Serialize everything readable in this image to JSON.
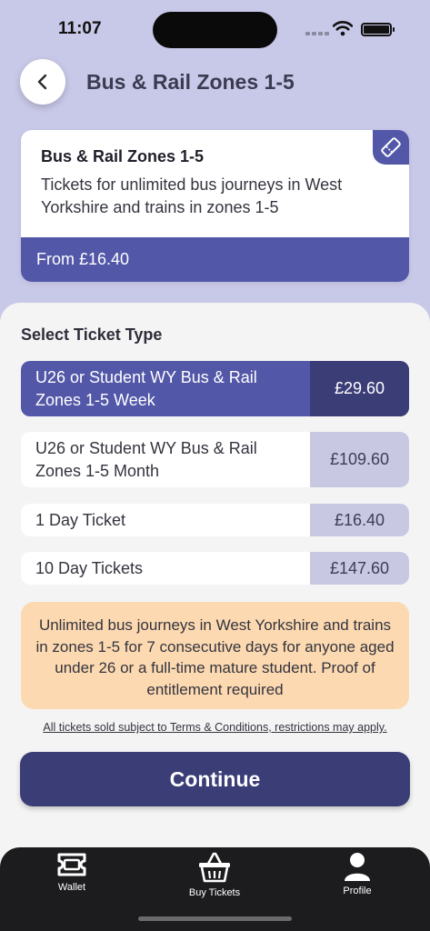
{
  "status_bar": {
    "time": "11:07"
  },
  "header": {
    "title": "Bus & Rail Zones 1-5"
  },
  "product": {
    "name": "Bus & Rail Zones 1-5",
    "description": "Tickets for unlimited bus journeys in West Yorkshire and trains in zones 1-5",
    "from_price": "From £16.40"
  },
  "ticket_section": {
    "title": "Select Ticket Type",
    "options": [
      {
        "label": "U26 or Student WY Bus & Rail Zones 1-5 Week",
        "price": "£29.60",
        "selected": true
      },
      {
        "label": "U26 or Student WY Bus & Rail Zones 1-5 Month",
        "price": "£109.60",
        "selected": false
      },
      {
        "label": "1 Day Ticket",
        "price": "£16.40",
        "selected": false
      },
      {
        "label": "10 Day Tickets",
        "price": "£147.60",
        "selected": false
      }
    ]
  },
  "info": {
    "text": "Unlimited bus journeys in West Yorkshire and trains in zones 1-5 for 7 consecutive days for anyone aged under 26 or a full-time mature student. Proof of entitlement required"
  },
  "terms": "All tickets sold subject to Terms & Conditions, restrictions may apply.",
  "continue_label": "Continue",
  "tab_bar": {
    "wallet": "Wallet",
    "buy_tickets": "Buy Tickets",
    "profile": "Profile"
  },
  "colors": {
    "accent": "#5257a8",
    "accent_dark": "#3b3d77",
    "header_bg": "#c8c8e8",
    "info_bg": "#fcd9b0",
    "tab_bar_bg": "#1c1c1e"
  },
  "icons": [
    "chevron-left-icon",
    "ticket-icon",
    "wallet-icon",
    "basket-icon",
    "profile-icon",
    "wifi-icon",
    "battery-icon"
  ]
}
